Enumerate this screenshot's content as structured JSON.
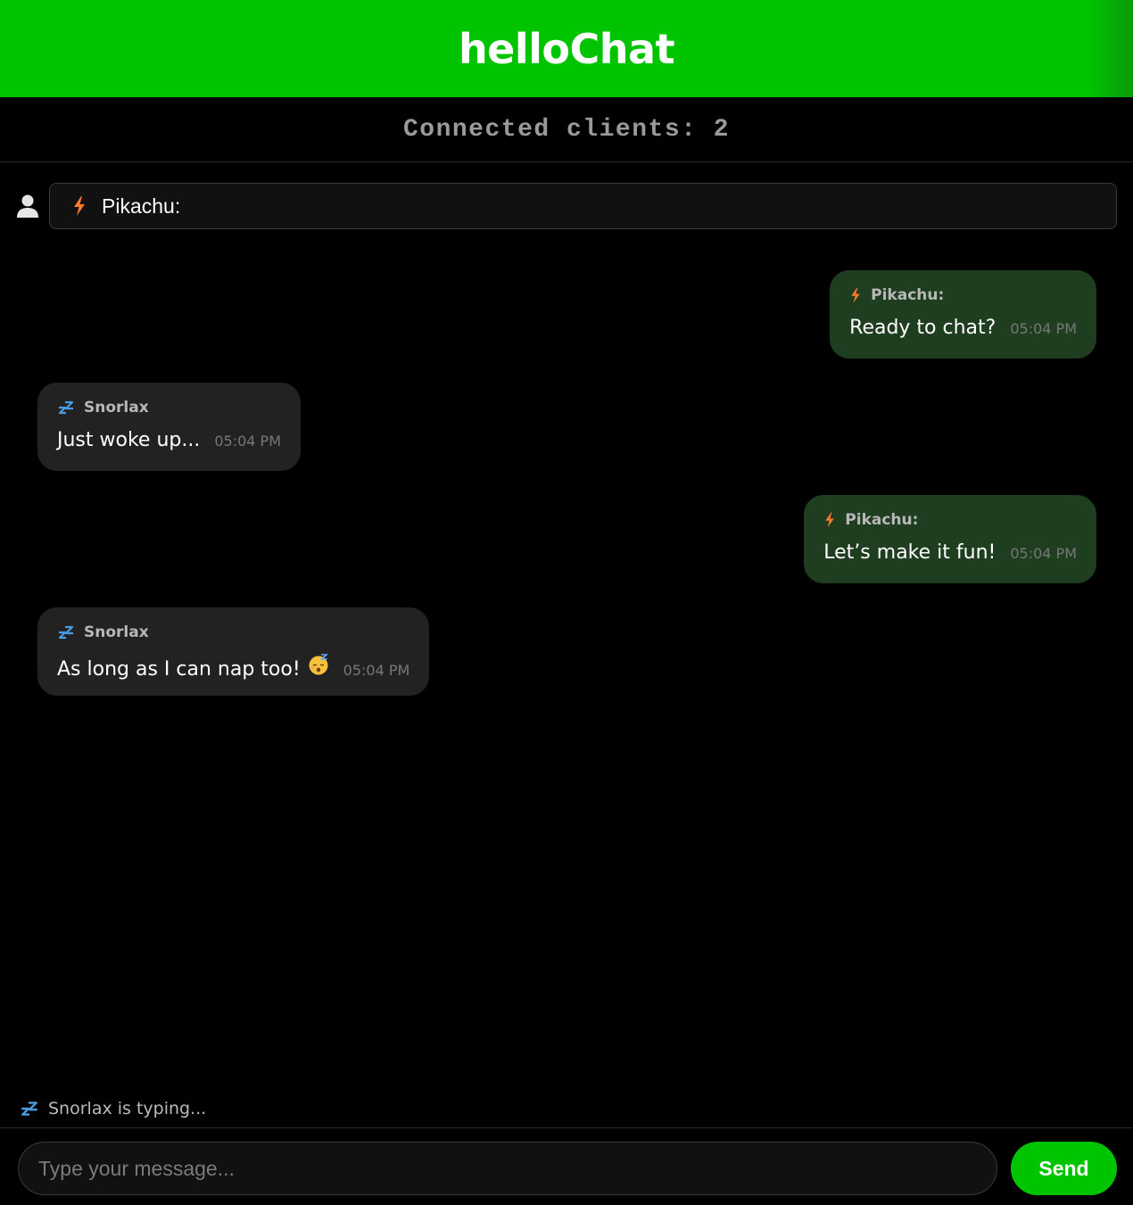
{
  "header": {
    "title": "helloChat"
  },
  "status": {
    "connected_clients": "Connected clients: 2"
  },
  "user": {
    "name_value": "Pikachu:",
    "avatar_icon": "user-icon",
    "badge_icon": "lightning-bolt-icon"
  },
  "messages": [
    {
      "sender": "Pikachu:",
      "icon": "lightning-bolt-icon",
      "text": "Ready to chat?",
      "time": "05:04 PM",
      "mine": true
    },
    {
      "sender": "Snorlax",
      "icon": "zzz-sleep-icon",
      "text": "Just woke up...",
      "time": "05:04 PM",
      "mine": false
    },
    {
      "sender": "Pikachu:",
      "icon": "lightning-bolt-icon",
      "text": "Let’s make it fun!",
      "time": "05:04 PM",
      "mine": true
    },
    {
      "sender": "Snorlax",
      "icon": "zzz-sleep-icon",
      "text": "As long as I can nap too!",
      "emoji": "sleeping-face-emoji",
      "time": "05:04 PM",
      "mine": false
    }
  ],
  "typing": {
    "text": "Snorlax is typing...",
    "icon": "zzz-sleep-icon"
  },
  "composer": {
    "placeholder": "Type your message...",
    "send_label": "Send"
  },
  "colors": {
    "accent": "#00c400",
    "my_bubble": "#1f3d1f",
    "their_bubble": "#222222",
    "bolt": "#ff7a2f",
    "zzz": "#4a9be0"
  }
}
